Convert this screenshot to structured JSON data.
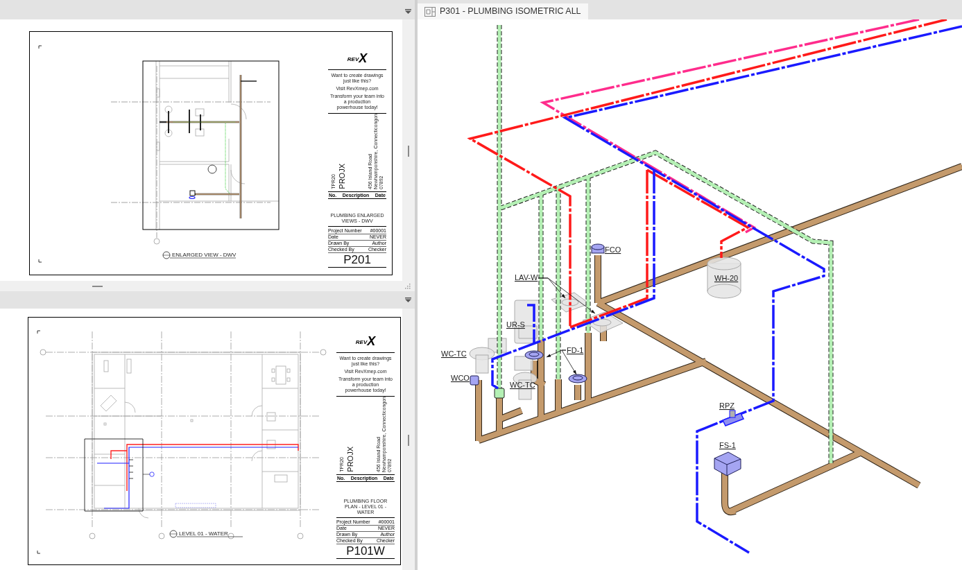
{
  "sheet_views": [
    {
      "kind": "enlarged_plan",
      "logo": [
        "REV",
        "X"
      ],
      "promo": [
        "Want to create drawings just like this?",
        "Visit RevXmep.com",
        "Transform your team into a production powerhouse today!"
      ],
      "project_code": "TPR20",
      "project_name": "PROJX",
      "address": [
        "456 Island Road",
        "Newhamponshire, Connecticongon",
        "07892"
      ],
      "revision_columns": [
        "No.",
        "Description",
        "Date"
      ],
      "sheet_title": "PLUMBING ENLARGED VIEWS - DWV",
      "fields": [
        {
          "label": "Project Number",
          "value": "#00001"
        },
        {
          "label": "Date",
          "value": "NEVER"
        },
        {
          "label": "Drawn By",
          "value": "Author"
        },
        {
          "label": "Checked By",
          "value": "Checker"
        }
      ],
      "sheet_number": "P201",
      "view_title": "ENLARGED VIEW - DWV"
    },
    {
      "kind": "floor_plan",
      "logo": [
        "REV",
        "X"
      ],
      "promo": [
        "Want to create drawings just like this?",
        "Visit RevXmep.com",
        "Transform your team into a production powerhouse today!"
      ],
      "project_code": "TPR20",
      "project_name": "PROJX",
      "address": [
        "456 Island Road",
        "Newhamponshire, Connecticongon",
        "07892"
      ],
      "revision_columns": [
        "No.",
        "Description",
        "Date"
      ],
      "sheet_title": "PLUMBING FLOOR PLAN - LEVEL 01 - WATER",
      "fields": [
        {
          "label": "Project Number",
          "value": "#00001"
        },
        {
          "label": "Date",
          "value": "NEVER"
        },
        {
          "label": "Drawn By",
          "value": "Author"
        },
        {
          "label": "Checked By",
          "value": "Checker"
        }
      ],
      "sheet_number": "P101W",
      "view_title": "LEVEL 01 - WATER"
    }
  ],
  "tabs": [
    {
      "title": "P301 - PLUMBING ISOMETRIC ALL",
      "selected": true
    }
  ],
  "isometric_tags": [
    "FCO",
    "LAV-W",
    "WH-20",
    "UR-S",
    "WC-TC",
    "FD-1",
    "WCO",
    "WC-TC",
    "RPZ",
    "FS-1"
  ]
}
